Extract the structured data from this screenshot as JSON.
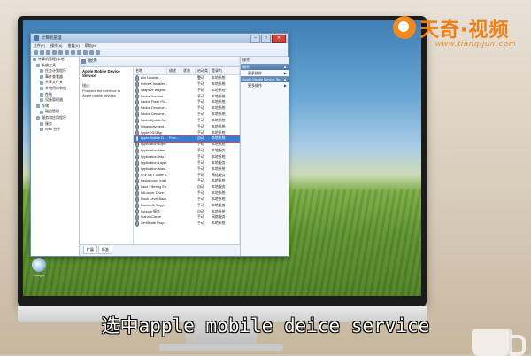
{
  "window": {
    "title": "计算机管理",
    "min": "–",
    "max": "□",
    "close": "✕",
    "menu": [
      "文件(F)",
      "操作(A)",
      "查看(V)",
      "帮助(H)"
    ]
  },
  "tree": [
    "计算机管理(本地)",
    "系统工具",
    "任务计划程序",
    "事件查看器",
    "共享文件夹",
    "本地用户和组",
    "性能",
    "设备管理器",
    "存储",
    "磁盘管理",
    "服务和应用程序",
    "服务",
    "WMI 控件"
  ],
  "center": {
    "header": "服务",
    "service_title": "Apple Mobile Device Service",
    "desc_label": "描述:",
    "desc_text": "Provides the interface to Apple mobile devices.",
    "columns": [
      "名称",
      "描述",
      "状态",
      "启动类型",
      "登录为"
    ],
    "rows": [
      {
        "name": "Win Update...",
        "desc": "",
        "status": "",
        "start": "手动",
        "logon": "本地系统"
      },
      {
        "name": "ActiveX Installer...",
        "desc": "",
        "status": "",
        "start": "手动",
        "logon": "本地系统"
      },
      {
        "name": "Adaptive Brightn...",
        "desc": "",
        "status": "",
        "start": "手动",
        "logon": "本地系统"
      },
      {
        "name": "Adobe Acrobat...",
        "desc": "",
        "status": "",
        "start": "手动",
        "logon": "本地系统"
      },
      {
        "name": "Adobe Flash Pla...",
        "desc": "",
        "status": "",
        "start": "手动",
        "logon": "本地系统"
      },
      {
        "name": "Adobe Genuine...",
        "desc": "",
        "status": "",
        "start": "手动",
        "logon": "本地系统"
      },
      {
        "name": "Adobe Genuine...",
        "desc": "",
        "status": "",
        "start": "手动",
        "logon": "本地系统"
      },
      {
        "name": "AdobeUpdateSe...",
        "desc": "",
        "status": "",
        "start": "手动",
        "logon": "本地系统"
      },
      {
        "name": "Alipay payment...",
        "desc": "",
        "status": "",
        "start": "手动",
        "logon": "本地系统"
      },
      {
        "name": "AppleOSSMgr",
        "desc": "",
        "status": "",
        "start": "手动",
        "logon": "本地系统"
      },
      {
        "name": "Apple Mobile D...",
        "desc": "Prov...",
        "status": "",
        "start": "自动",
        "logon": "本地系统"
      },
      {
        "name": "Application Expe...",
        "desc": "",
        "status": "",
        "start": "手动",
        "logon": "本地系统"
      },
      {
        "name": "Application Ident...",
        "desc": "",
        "status": "",
        "start": "手动",
        "logon": "本地服务"
      },
      {
        "name": "Application Info...",
        "desc": "",
        "status": "",
        "start": "手动",
        "logon": "本地系统"
      },
      {
        "name": "Application Layer...",
        "desc": "",
        "status": "",
        "start": "手动",
        "logon": "本地服务"
      },
      {
        "name": "Application Man...",
        "desc": "",
        "status": "",
        "start": "手动",
        "logon": "本地系统"
      },
      {
        "name": "ASP.NET State S...",
        "desc": "",
        "status": "",
        "start": "手动",
        "logon": "网络服务"
      },
      {
        "name": "Background Intel...",
        "desc": "",
        "status": "",
        "start": "手动",
        "logon": "本地系统"
      },
      {
        "name": "Base Filtering En...",
        "desc": "",
        "status": "",
        "start": "自动",
        "logon": "本地服务"
      },
      {
        "name": "BitLocker Drive...",
        "desc": "",
        "status": "",
        "start": "手动",
        "logon": "本地系统"
      },
      {
        "name": "Block Level Back...",
        "desc": "",
        "status": "",
        "start": "手动",
        "logon": "本地系统"
      },
      {
        "name": "Bluetooth Supp...",
        "desc": "",
        "status": "",
        "start": "手动",
        "logon": "本地服务"
      },
      {
        "name": "Bonjour 服务",
        "desc": "",
        "status": "",
        "start": "自动",
        "logon": "本地系统"
      },
      {
        "name": "BranchCache",
        "desc": "",
        "status": "",
        "start": "手动",
        "logon": "网络服务"
      },
      {
        "name": "Certificate Prop...",
        "desc": "",
        "status": "",
        "start": "手动",
        "logon": "本地系统"
      }
    ],
    "selected_index": 10,
    "tabs": [
      "扩展",
      "标准"
    ]
  },
  "actions": {
    "header": "操作",
    "section1": "服务",
    "item1": "更多操作",
    "section2": "Apple Mobile Device Se...",
    "item2": "更多操作"
  },
  "desktop_icon_label": "Google",
  "logo": {
    "text": "天奇·视频",
    "url": "www.tianqijun.com"
  },
  "subtitle": "选中apple mobile deice service",
  "colors": {
    "accent": "#3d7bd1",
    "logo_orange": "#f08a1e",
    "highlight_box": "#e24848"
  }
}
